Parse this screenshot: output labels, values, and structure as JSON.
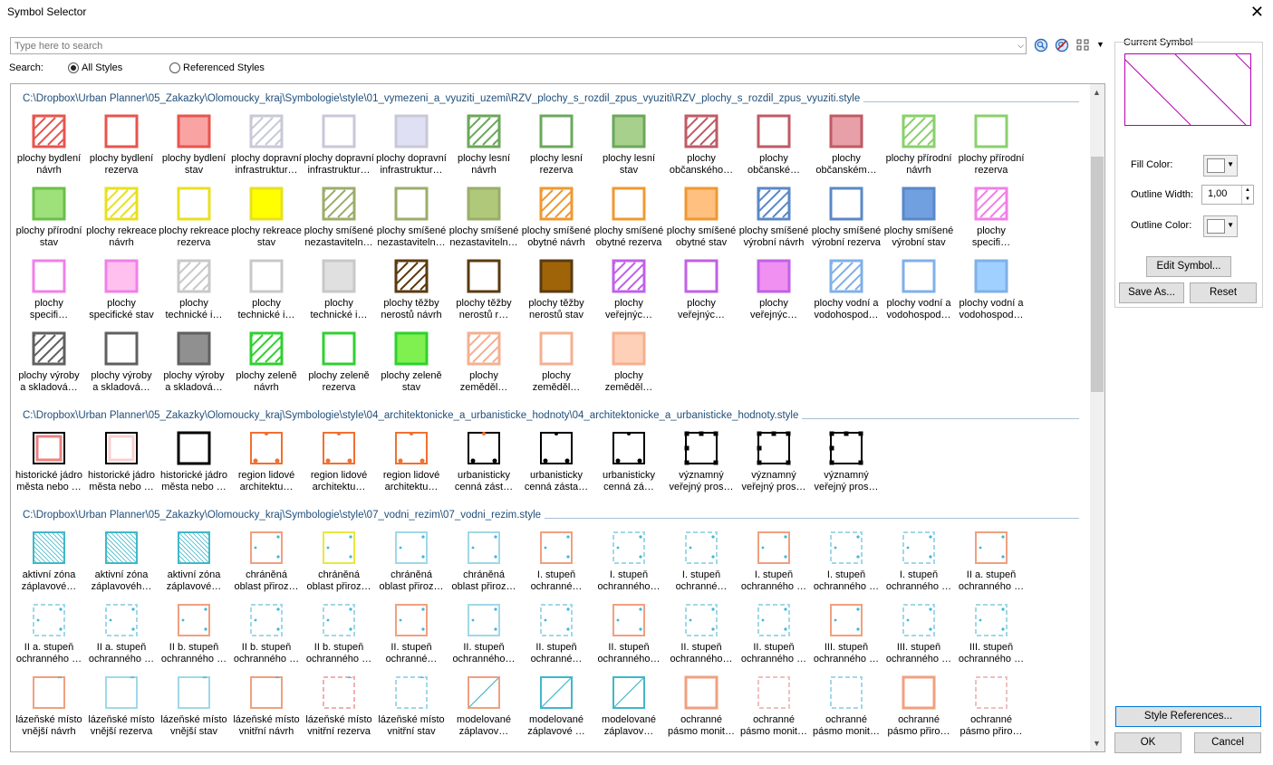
{
  "window": {
    "title": "Symbol Selector"
  },
  "search": {
    "placeholder": "Type here to search",
    "label": "Search:",
    "all_styles": "All Styles",
    "referenced_styles": "Referenced Styles"
  },
  "groups": [
    {
      "path": "C:\\Dropbox\\Urban Planner\\05_Zakazky\\Olomoucky_kraj\\Symbologie\\style\\01_vymezeni_a_vyuziti_uzemi\\RZV_plochy_s_rozdil_zpus_vyuziti\\RZV_plochy_s_rozdil_zpus_vyuziti.style",
      "items": [
        {
          "l": "plochy bydlení\nnávrh",
          "c": "#e8544e",
          "f": "none",
          "p": "hatch"
        },
        {
          "l": "plochy bydlení\nrezerva",
          "c": "#e8544e",
          "f": "none",
          "p": "plain"
        },
        {
          "l": "plochy bydlení\nstav",
          "c": "#e8544e",
          "f": "#f9a3a3",
          "p": "plain"
        },
        {
          "l": "plochy dopravní\ninfrastruktur…",
          "c": "#c8c8d8",
          "f": "none",
          "p": "hatch"
        },
        {
          "l": "plochy dopravní\ninfrastruktur…",
          "c": "#c8c8d8",
          "f": "none",
          "p": "plain"
        },
        {
          "l": "plochy dopravní\ninfrastruktur…",
          "c": "#c8c8d8",
          "f": "#e0e0f5",
          "p": "plain"
        },
        {
          "l": "plochy lesní\nnávrh",
          "c": "#6aa85a",
          "f": "none",
          "p": "hatch"
        },
        {
          "l": "plochy lesní\nrezerva",
          "c": "#6aa85a",
          "f": "none",
          "p": "plain"
        },
        {
          "l": "plochy lesní\nstav",
          "c": "#6aa85a",
          "f": "#a8d08d",
          "p": "plain"
        },
        {
          "l": "plochy\nobčanského…",
          "c": "#c05a66",
          "f": "none",
          "p": "hatch"
        },
        {
          "l": "plochy\nobčanské…",
          "c": "#c05a66",
          "f": "none",
          "p": "plain"
        },
        {
          "l": "plochy\nobčanském…",
          "c": "#c05a66",
          "f": "#e8a0a8",
          "p": "plain"
        },
        {
          "l": "plochy přírodní\nnávrh",
          "c": "#8ad06a",
          "f": "none",
          "p": "hatch"
        },
        {
          "l": "plochy přírodní\nrezerva",
          "c": "#8ad06a",
          "f": "none",
          "p": "plain"
        },
        {
          "l": "plochy přírodní\nstav",
          "c": "#6abf4a",
          "f": "#9ee07a",
          "p": "plain"
        },
        {
          "l": "plochy rekreace\nnávrh",
          "c": "#e8e020",
          "f": "none",
          "p": "hatch"
        },
        {
          "l": "plochy rekreace\nrezerva",
          "c": "#e8e020",
          "f": "none",
          "p": "plain"
        },
        {
          "l": "plochy rekreace\nstav",
          "c": "#e8e020",
          "f": "#ffff00",
          "p": "plain"
        },
        {
          "l": "plochy smíšené\nnezastaviteln…",
          "c": "#9aae6a",
          "f": "none",
          "p": "hatch"
        },
        {
          "l": "plochy smíšené\nnezastaviteln…",
          "c": "#9aae6a",
          "f": "none",
          "p": "plain"
        },
        {
          "l": "plochy smíšené\nnezastaviteln…",
          "c": "#9aae6a",
          "f": "#b0c87a",
          "p": "plain"
        },
        {
          "l": "plochy smíšené\nobytné návrh",
          "c": "#f09830",
          "f": "none",
          "p": "hatch"
        },
        {
          "l": "plochy smíšené\nobytné rezerva",
          "c": "#f09830",
          "f": "none",
          "p": "plain"
        },
        {
          "l": "plochy smíšené\nobytné stav",
          "c": "#f09830",
          "f": "#ffc080",
          "p": "plain"
        },
        {
          "l": "plochy smíšené\nvýrobní návrh",
          "c": "#5a88c8",
          "f": "none",
          "p": "hatch"
        },
        {
          "l": "plochy smíšené\nvýrobní rezerva",
          "c": "#5a88c8",
          "f": "none",
          "p": "plain"
        },
        {
          "l": "plochy smíšené\nvýrobní stav",
          "c": "#5a88c8",
          "f": "#70a0e0",
          "p": "plain"
        },
        {
          "l": "plochy\nspecifi…",
          "c": "#f080e8",
          "f": "none",
          "p": "hatch"
        },
        {
          "l": "plochy\nspecifi…",
          "c": "#f080e8",
          "f": "none",
          "p": "plain"
        },
        {
          "l": "plochy\nspecifické stav",
          "c": "#f080e8",
          "f": "#ffc0f0",
          "p": "plain"
        },
        {
          "l": "plochy\ntechnické i…",
          "c": "#c8c8c8",
          "f": "none",
          "p": "hatch"
        },
        {
          "l": "plochy\ntechnické i…",
          "c": "#c8c8c8",
          "f": "none",
          "p": "plain"
        },
        {
          "l": "plochy\ntechnické i…",
          "c": "#c8c8c8",
          "f": "#e0e0e0",
          "p": "plain"
        },
        {
          "l": "plochy těžby\nnerostů návrh",
          "c": "#5a3a10",
          "f": "none",
          "p": "hatch"
        },
        {
          "l": "plochy těžby\nnerostů r…",
          "c": "#5a3a10",
          "f": "none",
          "p": "plain"
        },
        {
          "l": "plochy těžby\nnerostů stav",
          "c": "#5a3a10",
          "f": "#a06408",
          "p": "plain"
        },
        {
          "l": "plochy\nveřejnýc…",
          "c": "#c060e8",
          "f": "none",
          "p": "hatch"
        },
        {
          "l": "plochy\nveřejnýc…",
          "c": "#c060e8",
          "f": "none",
          "p": "plain"
        },
        {
          "l": "plochy\nveřejnýc…",
          "c": "#c060e8",
          "f": "#f090f0",
          "p": "plain"
        },
        {
          "l": "plochy vodní a\nvodohospod…",
          "c": "#80b0e8",
          "f": "none",
          "p": "hatch"
        },
        {
          "l": "plochy vodní a\nvodohospod…",
          "c": "#80b0e8",
          "f": "none",
          "p": "plain"
        },
        {
          "l": "plochy vodní a\nvodohospod…",
          "c": "#80b0e8",
          "f": "#a0d0ff",
          "p": "plain"
        },
        {
          "l": "plochy výroby\na skladová…",
          "c": "#606060",
          "f": "none",
          "p": "hatch"
        },
        {
          "l": "plochy výroby\na skladová…",
          "c": "#606060",
          "f": "none",
          "p": "plain"
        },
        {
          "l": "plochy výroby\na skladová…",
          "c": "#606060",
          "f": "#909090",
          "p": "plain"
        },
        {
          "l": "plochy zeleně\nnávrh",
          "c": "#30d030",
          "f": "none",
          "p": "hatch"
        },
        {
          "l": "plochy zeleně\nrezerva",
          "c": "#30d030",
          "f": "none",
          "p": "plain"
        },
        {
          "l": "plochy zeleně\nstav",
          "c": "#30d030",
          "f": "#80f050",
          "p": "plain"
        },
        {
          "l": "plochy\nzeměděl…",
          "c": "#f4b090",
          "f": "none",
          "p": "hatch"
        },
        {
          "l": "plochy\nzeměděl…",
          "c": "#f4b090",
          "f": "none",
          "p": "plain"
        },
        {
          "l": "plochy\nzeměděl…",
          "c": "#f4b090",
          "f": "#ffd0b8",
          "p": "plain"
        }
      ]
    },
    {
      "path": "C:\\Dropbox\\Urban Planner\\05_Zakazky\\Olomoucky_kraj\\Symbologie\\style\\04_architektonicke_a_urbanisticke_hodnoty\\04_architektonicke_a_urbanisticke_hodnoty.style",
      "items": [
        {
          "l": "historické jádro\nměsta nebo …",
          "c": "#000000",
          "f": "none",
          "p": "inner",
          "c2": "#f08080"
        },
        {
          "l": "historické jádro\nměsta nebo …",
          "c": "#000000",
          "f": "none",
          "p": "inner",
          "c2": "#f8d0d0"
        },
        {
          "l": "historické jádro\nměsta nebo …",
          "c": "#000000",
          "f": "none",
          "p": "plain"
        },
        {
          "l": "region lidové\narchitektu…",
          "c": "#f07030",
          "f": "none",
          "p": "dots"
        },
        {
          "l": "region lidové\narchitektu…",
          "c": "#f07030",
          "f": "none",
          "p": "dots"
        },
        {
          "l": "region lidové\narchitektu…",
          "c": "#f07030",
          "f": "none",
          "p": "dots"
        },
        {
          "l": "urbanisticky\ncenná zást…",
          "c": "#000000",
          "f": "none",
          "p": "dots",
          "c2": "#f07030"
        },
        {
          "l": "urbanisticky\ncenná zásta…",
          "c": "#000000",
          "f": "none",
          "p": "dots"
        },
        {
          "l": "urbanisticky\ncenná zá…",
          "c": "#000000",
          "f": "none",
          "p": "dots"
        },
        {
          "l": "významný\nveřejný pros…",
          "c": "#000000",
          "f": "none",
          "p": "corners",
          "c2": "#f07030"
        },
        {
          "l": "významný\nveřejný pros…",
          "c": "#000000",
          "f": "none",
          "p": "corners"
        },
        {
          "l": "významný\nveřejný pros…",
          "c": "#000000",
          "f": "none",
          "p": "corners"
        }
      ]
    },
    {
      "path": "C:\\Dropbox\\Urban Planner\\05_Zakazky\\Olomoucky_kraj\\Symbologie\\style\\07_vodni_rezim\\07_vodni_rezim.style",
      "items": [
        {
          "l": "aktivní zóna\nzáplavové…",
          "c": "#40b8c8",
          "f": "none",
          "p": "hatch2",
          "c2": "#f09070"
        },
        {
          "l": "aktivní zóna\nzáplavovéh…",
          "c": "#40b8c8",
          "f": "none",
          "p": "hatch2"
        },
        {
          "l": "aktivní zóna\nzáplavové…",
          "c": "#40b8c8",
          "f": "none",
          "p": "hatch2"
        },
        {
          "l": "chráněná\noblast přiroz…",
          "c": "#f0a080",
          "f": "none",
          "p": "water"
        },
        {
          "l": "chráněná\noblast přiroz…",
          "c": "#e8e840",
          "f": "none",
          "p": "water"
        },
        {
          "l": "chráněná\noblast přiroz…",
          "c": "#a0d8e8",
          "f": "none",
          "p": "water"
        },
        {
          "l": "chráněná\noblast přiroz…",
          "c": "#a0d8e8",
          "f": "none",
          "p": "water"
        },
        {
          "l": "I. stupeň\nochranné…",
          "c": "#f0a080",
          "f": "none",
          "p": "water"
        },
        {
          "l": "I. stupeň\nochranného…",
          "c": "#a0d8e8",
          "f": "none",
          "p": "waterdash"
        },
        {
          "l": "I. stupeň\nochranné…",
          "c": "#a0d8e8",
          "f": "none",
          "p": "waterdash"
        },
        {
          "l": "I. stupeň\nochranného …",
          "c": "#f0a080",
          "f": "none",
          "p": "water"
        },
        {
          "l": "I. stupeň\nochranného …",
          "c": "#a0d8e8",
          "f": "none",
          "p": "waterdash"
        },
        {
          "l": "I. stupeň\nochranného …",
          "c": "#a0d8e8",
          "f": "none",
          "p": "waterdash"
        },
        {
          "l": "II a. stupeň\nochranného …",
          "c": "#f0a080",
          "f": "none",
          "p": "water"
        },
        {
          "l": "II a. stupeň\nochranného …",
          "c": "#a0d8e8",
          "f": "none",
          "p": "waterdash"
        },
        {
          "l": "II a. stupeň\nochranného …",
          "c": "#a0d8e8",
          "f": "none",
          "p": "waterdash"
        },
        {
          "l": "II b. stupeň\nochranného …",
          "c": "#f0a080",
          "f": "none",
          "p": "water"
        },
        {
          "l": "II b. stupeň\nochranného …",
          "c": "#a0d8e8",
          "f": "none",
          "p": "waterdash"
        },
        {
          "l": "II b. stupeň\nochranného …",
          "c": "#a0d8e8",
          "f": "none",
          "p": "waterdash"
        },
        {
          "l": "II. stupeň\nochranné…",
          "c": "#f0a080",
          "f": "none",
          "p": "water"
        },
        {
          "l": "II. stupeň\nochranného…",
          "c": "#a0d8e8",
          "f": "none",
          "p": "water"
        },
        {
          "l": "II. stupeň\nochranné…",
          "c": "#a0d8e8",
          "f": "none",
          "p": "waterdash"
        },
        {
          "l": "II. stupeň\nochranného…",
          "c": "#f0a080",
          "f": "none",
          "p": "water"
        },
        {
          "l": "II. stupeň\nochranného…",
          "c": "#a0d8e8",
          "f": "none",
          "p": "waterdash"
        },
        {
          "l": "II. stupeň\nochranného …",
          "c": "#a0d8e8",
          "f": "none",
          "p": "waterdash"
        },
        {
          "l": "III. stupeň\nochranného …",
          "c": "#f0a080",
          "f": "none",
          "p": "water"
        },
        {
          "l": "III. stupeň\nochranného …",
          "c": "#a0d8e8",
          "f": "none",
          "p": "waterdash"
        },
        {
          "l": "III. stupeň\nochranného …",
          "c": "#a0d8e8",
          "f": "none",
          "p": "waterdash"
        },
        {
          "l": "lázeňské místo\nvnější návrh",
          "c": "#f0a080",
          "f": "none",
          "p": "spa"
        },
        {
          "l": "lázeňské místo\nvnější rezerva",
          "c": "#a0d8e8",
          "f": "none",
          "p": "spa"
        },
        {
          "l": "lázeňské místo\nvnější stav",
          "c": "#a0d8e8",
          "f": "none",
          "p": "spa"
        },
        {
          "l": "lázeňské místo\nvnitřní návrh",
          "c": "#f0a080",
          "f": "none",
          "p": "spa"
        },
        {
          "l": "lázeňské místo\nvnitřní rezerva",
          "c": "#f0b0b0",
          "f": "none",
          "p": "spadash"
        },
        {
          "l": "lázeňské místo\nvnitřní stav",
          "c": "#a0d8e8",
          "f": "none",
          "p": "spadash"
        },
        {
          "l": "modelované\nzáplavov…",
          "c": "#f0a080",
          "f": "none",
          "p": "diag"
        },
        {
          "l": "modelované\nzáplavové …",
          "c": "#40b8c8",
          "f": "none",
          "p": "diag"
        },
        {
          "l": "modelované\nzáplavov…",
          "c": "#40b8c8",
          "f": "none",
          "p": "diag"
        },
        {
          "l": "ochranné\npásmo monit…",
          "c": "#f0a080",
          "f": "none",
          "p": "plain"
        },
        {
          "l": "ochranné\npásmo monit…",
          "c": "#f0c0c0",
          "f": "none",
          "p": "dash"
        },
        {
          "l": "ochranné\npásmo monit…",
          "c": "#a0d8e8",
          "f": "none",
          "p": "dash"
        },
        {
          "l": "ochranné\npásmo přiro…",
          "c": "#f0a080",
          "f": "none",
          "p": "plain"
        },
        {
          "l": "ochranné\npásmo přiro…",
          "c": "#f0c0c0",
          "f": "none",
          "p": "dash"
        }
      ]
    }
  ],
  "current_symbol": {
    "label": "Current Symbol",
    "outline": "#b400b4"
  },
  "props": {
    "fill_color": "Fill Color:",
    "outline_width": "Outline Width:",
    "outline_width_value": "1,00",
    "outline_color": "Outline Color:"
  },
  "buttons": {
    "edit_symbol": "Edit Symbol...",
    "save_as": "Save As...",
    "reset": "Reset",
    "style_references": "Style References...",
    "ok": "OK",
    "cancel": "Cancel"
  }
}
